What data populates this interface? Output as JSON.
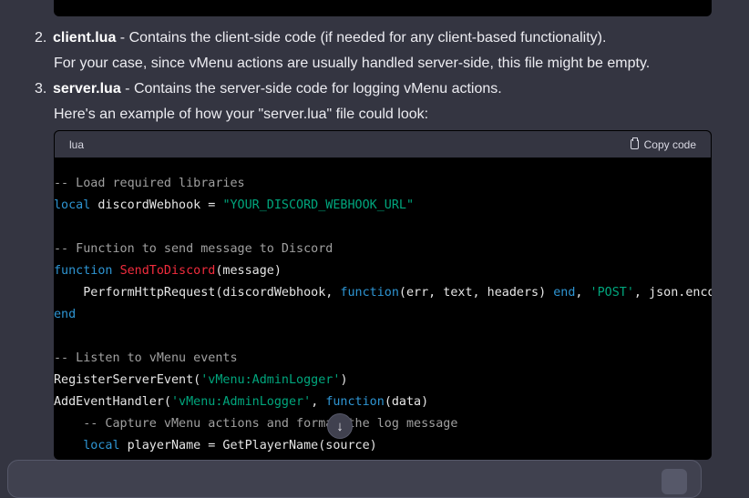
{
  "items": [
    {
      "number": "2.",
      "name": "client.lua",
      "desc": " - Contains the client-side code (if needed for any client-based functionality).",
      "note": "For your case, since vMenu actions are usually handled server-side, this file might be empty."
    },
    {
      "number": "3.",
      "name": "server.lua",
      "desc": " - Contains the server-side code for logging vMenu actions.",
      "note": "Here's an example of how your \"server.lua\" file could look:"
    }
  ],
  "code_block": {
    "language": "lua",
    "copy_label": "Copy code",
    "lines": [
      [
        {
          "t": "c",
          "v": "-- Load required libraries"
        }
      ],
      [
        {
          "t": "k",
          "v": "local"
        },
        {
          "t": "p",
          "v": " discordWebhook = "
        },
        {
          "t": "s",
          "v": "\"YOUR_DISCORD_WEBHOOK_URL\""
        }
      ],
      [],
      [
        {
          "t": "c",
          "v": "-- Function to send message to Discord"
        }
      ],
      [
        {
          "t": "k",
          "v": "function"
        },
        {
          "t": "p",
          "v": " "
        },
        {
          "t": "f",
          "v": "SendToDiscord"
        },
        {
          "t": "p",
          "v": "(message)"
        }
      ],
      [
        {
          "t": "p",
          "v": "    PerformHttpRequest(discordWebhook, "
        },
        {
          "t": "k",
          "v": "function"
        },
        {
          "t": "p",
          "v": "(err, text, headers) "
        },
        {
          "t": "k",
          "v": "end"
        },
        {
          "t": "p",
          "v": ", "
        },
        {
          "t": "s",
          "v": "'POST'"
        },
        {
          "t": "p",
          "v": ", json.encode"
        }
      ],
      [
        {
          "t": "k",
          "v": "end"
        }
      ],
      [],
      [
        {
          "t": "c",
          "v": "-- Listen to vMenu events"
        }
      ],
      [
        {
          "t": "p",
          "v": "RegisterServerEvent("
        },
        {
          "t": "s",
          "v": "'vMenu:AdminLogger'"
        },
        {
          "t": "p",
          "v": ")"
        }
      ],
      [
        {
          "t": "p",
          "v": "AddEventHandler("
        },
        {
          "t": "s",
          "v": "'vMenu:AdminLogger'"
        },
        {
          "t": "p",
          "v": ", "
        },
        {
          "t": "k",
          "v": "function"
        },
        {
          "t": "p",
          "v": "(data)"
        }
      ],
      [
        {
          "t": "c",
          "v": "    -- Capture vMenu actions and format the log message"
        }
      ],
      [
        {
          "t": "p",
          "v": "    "
        },
        {
          "t": "k",
          "v": "local"
        },
        {
          "t": "p",
          "v": " playerName = GetPlayerName(source)"
        }
      ]
    ]
  },
  "icons": {
    "copy": "clipboard-icon",
    "scroll": "arrow-down-icon"
  }
}
